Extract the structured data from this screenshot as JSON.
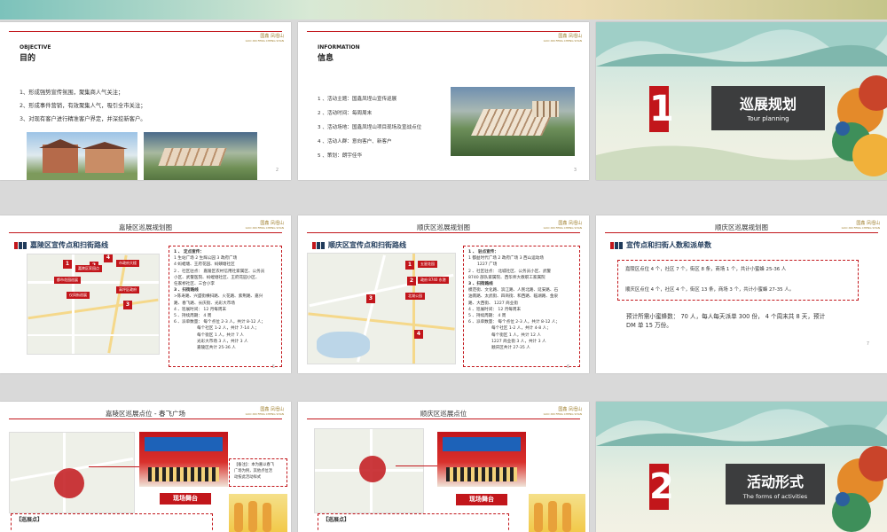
{
  "slides": {
    "objective": {
      "heading_en": "OBJECTIVE",
      "heading_cn": "目的",
      "items": [
        "1、形成强势宣传氛围，聚集商人气关注；",
        "2、形成事件营销，有效聚集人气，吸引全市关注；",
        "3、对现有客户进行精准客户界定，并深挖新客户。"
      ],
      "page": "2"
    },
    "information": {
      "heading_en": "INFORMATION",
      "heading_cn": "信息",
      "items": [
        "1 、活动主题：国鑫凤埕山宣传巡展",
        "2 、活动时间：每周周末",
        "3 、活动场地：国鑫凤埕山项目现场及宣战点位",
        "4 、活动人群：意向客户、新客户",
        "5 、策划：朗宇佳华"
      ],
      "page": "3"
    },
    "cover1": {
      "number": "1",
      "title_cn": "巡展规划",
      "title_en": "Tour planning"
    },
    "jialing": {
      "header": "嘉陵区巡展规划图",
      "title": "嘉陵区宣传点和扫街路线",
      "map_pins": [
        "1",
        "2",
        "3",
        "4"
      ],
      "map_tags": [
        "都市花园巡展",
        "嘉陵区高家巷",
        "高坪区政府",
        "市政府大楼",
        "嘉陵区家园点",
        "仪凤街巡展"
      ],
      "info": [
        "1 、 定点宣传：",
        "1 生站广场 2 生辉公园 3 政府广场",
        "4 蚂蝗塘、王府花园、蚂蟥塘社区",
        "2 、社区驻点：  嘉陵区农村信用社家属区、公务员",
        "小区、武警医院、蚂蝗塘社区、王府花园小区、",
        "任家桥社区、三合小李",
        "3 、扫街路线",
        ">陈寿路、兴盛街横扫路、火花路、紫荆路、嘉兴",
        "路、春飞路、长庆街、光彩大市场",
        "4 、巡展时间：   12 月每周末",
        "5 、持续周期：   4 周",
        "6 、派单数量：  每个点位 2-3 人，共计 8-12 人；",
        "每个社区 1-2 人，共计 7-14 人；",
        "每个街区 1 人，共计 7 人",
        "光彩大市场 3 人，共计 3 人",
        "嘉陵区共计 25-36 人"
      ],
      "page": "5"
    },
    "shunqing": {
      "header": "顺庆区巡展规划图",
      "title": "顺庆区宣传点和扫街路线",
      "map_pins": [
        "1",
        "2",
        "3",
        "4"
      ],
      "map_tags": [
        "五星花园",
        "北湖公园",
        "政府 8740 东港"
      ],
      "info": [
        "1 、 驻点宣传：",
        "1 都益时代广场 2 政府广场 3 西山运动场",
        "1227 广场",
        "2 、社区驻点：  北城社区、公务员小区、武警",
        "8740 部队家属院、西华师大教职工家属院",
        "3 、扫街路线",
        "模范街、文化路、滨江路、人民北路、延安路、石",
        "油南路、太武街、四商街、和西路、临湖路、金泉",
        "路、大西街、 1227 商业街",
        "4 、巡展时间：   12 月每周末",
        "5 、持续周期：   4 周",
        "6 、派单数量：  每个点位 2-3 人，共计 8-12 人；",
        "每个社区 1-2 人，共计 4-8 人；",
        "每个街区 1 人，共计 12 人",
        "1227 商业街 3 人，共计 3 人",
        "顺庆区共计 27-35 人"
      ],
      "page": "6"
    },
    "count": {
      "header": "顺庆区巡展规划图",
      "title": "宣传点和扫街人数和派单数",
      "line1": "嘉陵区点位 4 个，社区 7 个，街区 8 条，商场 1 个，共计小蜜蜂 25-36 人",
      "line2": "顺庆区点位 4 个，社区 4 个，街区 13 条，商场 3 个，共计小蜜蜂 27-35 人。",
      "summary1": "预计所需小蜜蜂数：  70 人，每人每天派单 300 份，  4 个周末共 8 天，预计",
      "summary2": "DM 单 15 万份。",
      "page": "7"
    },
    "jialing_site": {
      "header": "嘉陵区巡展点位 - 春飞广场",
      "stage_label": "现场舞台",
      "note": [
        "【备注】：本为嘉以春飞",
        "广场为例，其他点位活",
        "动按此活动样式"
      ],
      "bottom_label": "【巡展点】"
    },
    "shunqing_site": {
      "header": "顺庆区巡展点位",
      "stage_label": "现场舞台",
      "bottom_label": "【巡展点】"
    },
    "cover2": {
      "number": "2",
      "title_cn": "活动形式",
      "title_en": "The forms of activities"
    }
  },
  "logo": {
    "top": "国鑫 凤埕山",
    "bottom": "GUO XIN FENG CHENG SHAN"
  },
  "colors": {
    "brand_red": "#c2161b",
    "navy": "#1f3a5a",
    "dark_box": "#3c3d3e"
  }
}
